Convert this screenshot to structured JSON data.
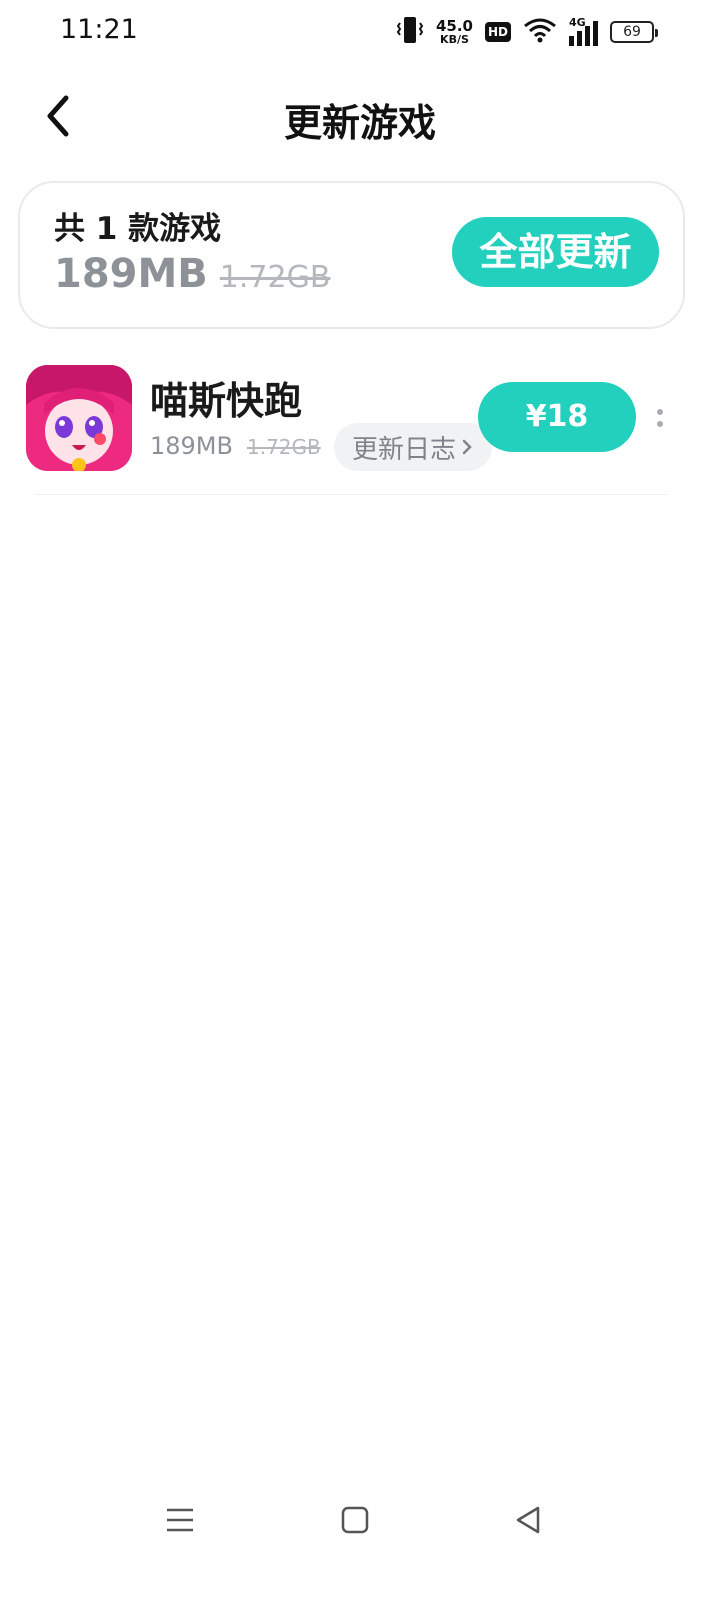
{
  "status_bar": {
    "time": "11:21",
    "net_speed_value": "45.0",
    "net_speed_unit": "KB/S",
    "hd_label": "HD",
    "network_label": "4G",
    "battery": "69",
    "icons": [
      "vibrate-icon",
      "wifi-icon",
      "signal-icon",
      "battery-icon"
    ]
  },
  "header": {
    "title": "更新游戏",
    "back_icon": "chevron-left-icon"
  },
  "summary": {
    "count_text": "共 1 款游戏",
    "size_new": "189MB",
    "size_old": "1.72GB",
    "update_all_label": "全部更新"
  },
  "games": [
    {
      "name": "喵斯快跑",
      "size_new": "189MB",
      "size_old": "1.72GB",
      "changelog_label": "更新日志",
      "price_label": "¥18",
      "icon": "game-avatar-icon"
    }
  ],
  "colors": {
    "accent": "#22d0bd",
    "secondary_text": "#8c9298",
    "strikethrough_text": "#b4b8bd",
    "card_border": "#e8eaee"
  },
  "nav_bar": {
    "icons": [
      "menu-icon",
      "home-square-icon",
      "back-triangle-icon"
    ]
  }
}
